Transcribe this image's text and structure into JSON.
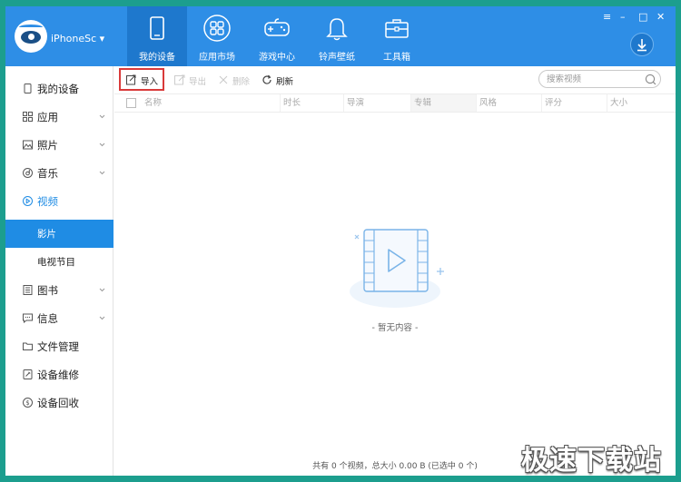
{
  "window": {
    "device_name": "iPhoneSc ▾",
    "controls": {
      "menu": "≡",
      "minimize": "–",
      "maximize": "□",
      "close": "✕"
    }
  },
  "nav": {
    "items": [
      {
        "label": "我的设备",
        "icon": "phone-icon",
        "active": true
      },
      {
        "label": "应用市场",
        "icon": "apps-icon",
        "active": false
      },
      {
        "label": "游戏中心",
        "icon": "gamepad-icon",
        "active": false
      },
      {
        "label": "铃声壁纸",
        "icon": "bell-icon",
        "active": false
      },
      {
        "label": "工具箱",
        "icon": "toolbox-icon",
        "active": false
      }
    ]
  },
  "sidebar": {
    "items": [
      {
        "label": "我的设备",
        "icon": "phone-icon"
      },
      {
        "label": "应用",
        "icon": "apps-icon"
      },
      {
        "label": "照片",
        "icon": "image-icon"
      },
      {
        "label": "音乐",
        "icon": "music-icon"
      },
      {
        "label": "视频",
        "icon": "play-icon"
      },
      {
        "label": "影片",
        "icon": ""
      },
      {
        "label": "电视节目",
        "icon": ""
      },
      {
        "label": "图书",
        "icon": "book-icon"
      },
      {
        "label": "信息",
        "icon": "message-icon"
      },
      {
        "label": "文件管理",
        "icon": "folder-icon"
      },
      {
        "label": "设备维修",
        "icon": "wrench-icon"
      },
      {
        "label": "设备回收",
        "icon": "recycle-icon"
      }
    ]
  },
  "toolbar": {
    "import": "导入",
    "export": "导出",
    "delete": "删除",
    "refresh": "刷新",
    "search_placeholder": "搜索视频"
  },
  "table": {
    "columns": [
      "名称",
      "时长",
      "导演",
      "专辑",
      "风格",
      "评分",
      "大小"
    ]
  },
  "empty_text": "- 暂无内容 -",
  "status": "共有 0 个视频，总大小 0.00 B (已选中 0 个)",
  "watermark": "极速下载站",
  "colors": {
    "accent": "#2e8ee6",
    "nav_active": "#1e78cd",
    "sidebar_selected": "#1f8ce4",
    "highlight_box": "#d93a3a",
    "outer_background": "#1c9e8e"
  }
}
